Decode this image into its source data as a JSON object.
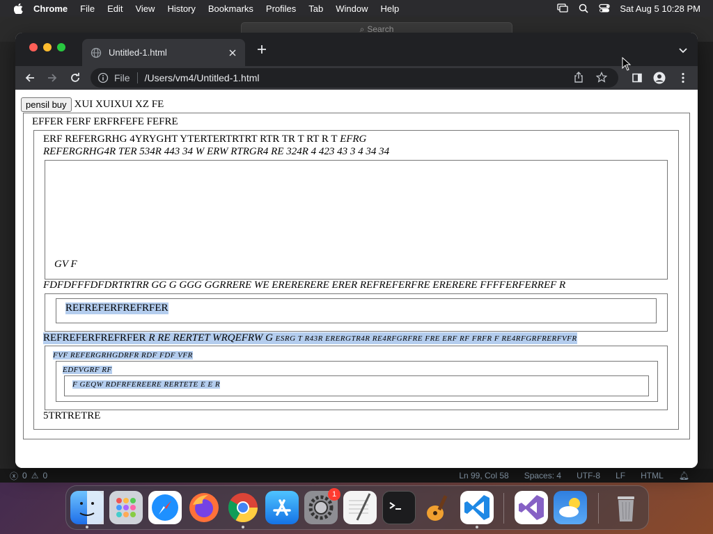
{
  "menubar": {
    "app": "Chrome",
    "items": [
      "File",
      "Edit",
      "View",
      "History",
      "Bookmarks",
      "Profiles",
      "Tab",
      "Window",
      "Help"
    ],
    "clock": "Sat Aug 5  10:28 PM"
  },
  "editor": {
    "search_label": "Search",
    "status": {
      "errors": "0",
      "warnings": "0",
      "position": "Ln 99, Col 58",
      "spaces": "Spaces: 4",
      "encoding": "UTF-8",
      "eol": "LF",
      "language": "HTML"
    }
  },
  "browser": {
    "tab_title": "Untitled-1.html",
    "omnibox_chip": "File",
    "url": "/Users/vm4/Untitled-1.html"
  },
  "page": {
    "button_label": "pensil buy",
    "top_text": "XUI XUIXUI XZ FE",
    "outer_legend": "EFFER FERF ERFRFEFE FEFRE",
    "line1_normal": "ERF REFERGRHG 4YRYGHT YTERTERTRTRT RTR TR T RT R T",
    "line1_italic": "EFRG",
    "line2_italic": "REFERGRHG4R TER 534R 443 34 W ERW RTRGR4 RE 324R 4 423 43 3 4 34 34",
    "box1_text": "GV F",
    "line3_italic": "FDFDFFFDFDRTRTRR GG G GGG GGRRERE WE ERERERERE ERER REFREFERFRE ERERERE FFFFERFERREF R",
    "box2_inner": "REFREFERFREFRFER",
    "line4_normal": "REFREFERFREFRFER",
    "line4_italic": "R RE RERTET WRQEFRW G",
    "line4_small": "ESRG T R43R ERERGTR4R RE4RFGRFRE FRE ERF RF FRFR F RE4RFGRFRERFVFR",
    "box3_line1": "FVF REFERGRHGDRFR RDF FDF VFR",
    "box3_line2": "EDFVGRF RF",
    "box3_line3": "F GEQW RDFRFEREERE RERTETE E E R",
    "bottom_text": "5TRTRETRE"
  },
  "dock": {
    "badge": "1"
  }
}
